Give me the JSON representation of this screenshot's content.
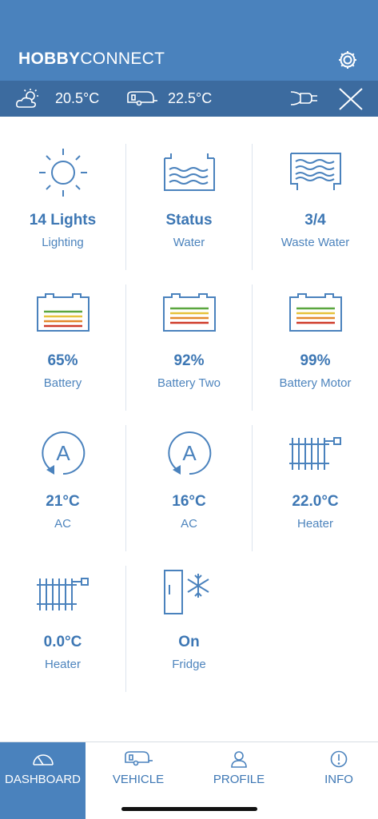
{
  "header": {
    "brand_bold": "HOBBY",
    "brand_light": "CONNECT",
    "settings_icon": "gear-icon"
  },
  "status": {
    "outside_temp": "20.5°C",
    "inside_temp": "22.5°C",
    "power_icon": "plug-icon",
    "close_icon": "close-icon"
  },
  "tiles": [
    {
      "value": "14 Lights",
      "label": "Lighting",
      "icon": "sun-icon"
    },
    {
      "value": "Status",
      "label": "Water",
      "icon": "water-tank-icon"
    },
    {
      "value": "3/4",
      "label": "Waste Water",
      "icon": "waste-water-icon"
    },
    {
      "value": "65%",
      "label": "Battery",
      "icon": "battery-icon"
    },
    {
      "value": "92%",
      "label": "Battery Two",
      "icon": "battery-icon"
    },
    {
      "value": "99%",
      "label": "Battery Motor",
      "icon": "battery-icon"
    },
    {
      "value": "21°C",
      "label": "AC",
      "icon": "ac-icon"
    },
    {
      "value": "16°C",
      "label": "AC",
      "icon": "ac-icon"
    },
    {
      "value": "22.0°C",
      "label": "Heater",
      "icon": "heater-icon"
    },
    {
      "value": "0.0°C",
      "label": "Heater",
      "icon": "heater-icon"
    },
    {
      "value": "On",
      "label": "Fridge",
      "icon": "fridge-icon"
    }
  ],
  "tabs": [
    {
      "label": "DASHBOARD",
      "icon": "speedometer-icon",
      "active": true
    },
    {
      "label": "VEHICLE",
      "icon": "caravan-icon",
      "active": false
    },
    {
      "label": "PROFILE",
      "icon": "person-icon",
      "active": false
    },
    {
      "label": "INFO",
      "icon": "info-icon",
      "active": false
    }
  ],
  "colors": {
    "primary": "#4a82bd",
    "statusbar": "#3c6b9f",
    "battery_green": "#5aa63e",
    "battery_yellow": "#e6c23a",
    "battery_orange": "#e38a2d",
    "battery_red": "#cf3b2a"
  }
}
